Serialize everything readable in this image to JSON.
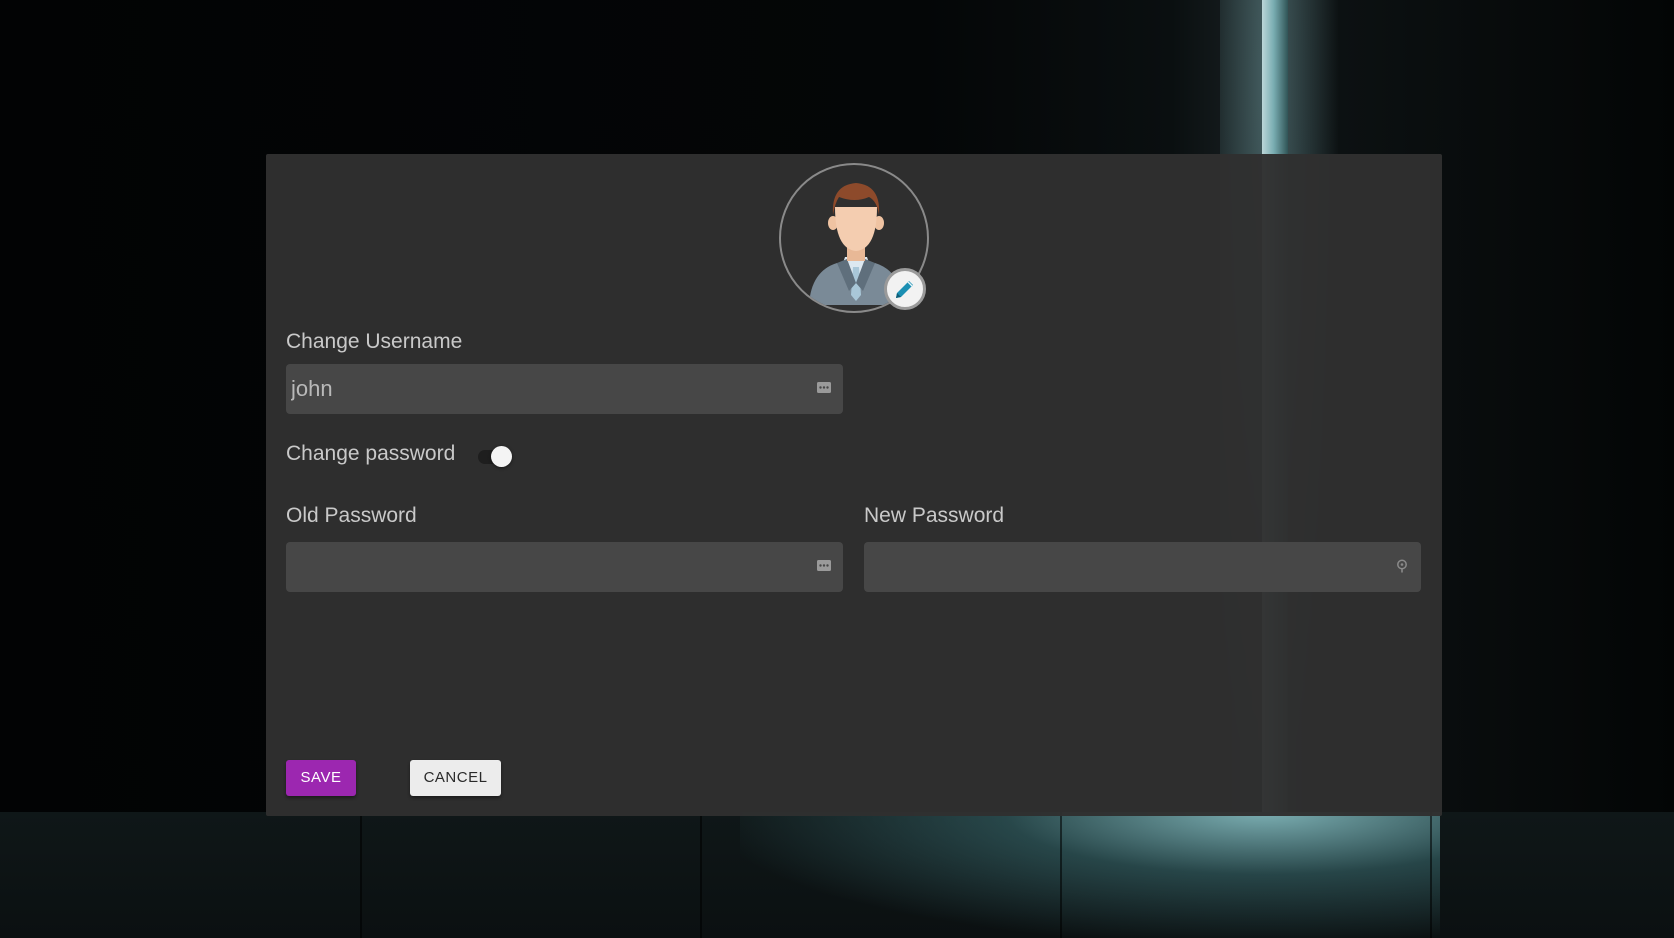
{
  "profile_form": {
    "username_label": "Change Username",
    "username_value": "john",
    "change_password_label": "Change password",
    "change_password_enabled": true,
    "old_password_label": "Old Password",
    "old_password_value": "",
    "new_password_label": "New Password",
    "new_password_value": "",
    "save_label": "SAVE",
    "cancel_label": "CANCEL"
  },
  "icons": {
    "avatar": "person-avatar-icon",
    "edit": "pencil-icon",
    "username_field": "more-horizontal-icon",
    "old_password_field": "more-horizontal-icon",
    "new_password_field": "key-icon"
  },
  "colors": {
    "save_button": "#9c27b0",
    "cancel_button": "#ececec",
    "dialog_background": "#303030",
    "field_background": "#474747"
  }
}
